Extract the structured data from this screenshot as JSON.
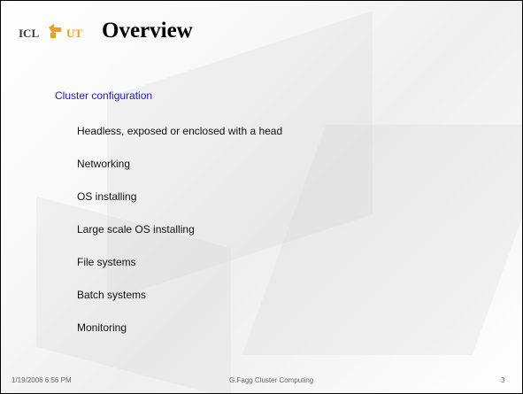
{
  "slide": {
    "title": "Overview",
    "logo_icon": "icl-logo-icon",
    "section_heading": "Cluster configuration",
    "bullets": [
      "Headless, exposed or enclosed with a head",
      "Networking",
      "OS installing",
      "Large scale OS installing",
      "File systems",
      "Batch systems",
      "Monitoring"
    ]
  },
  "footer": {
    "date": "1/19/2006 6:56 PM",
    "center": "G.Fagg Cluster Computing",
    "page": "3"
  },
  "colors": {
    "heading": "#1e1eb4",
    "logo_orange": "#e8a21e",
    "logo_dark": "#3a3a3a"
  }
}
